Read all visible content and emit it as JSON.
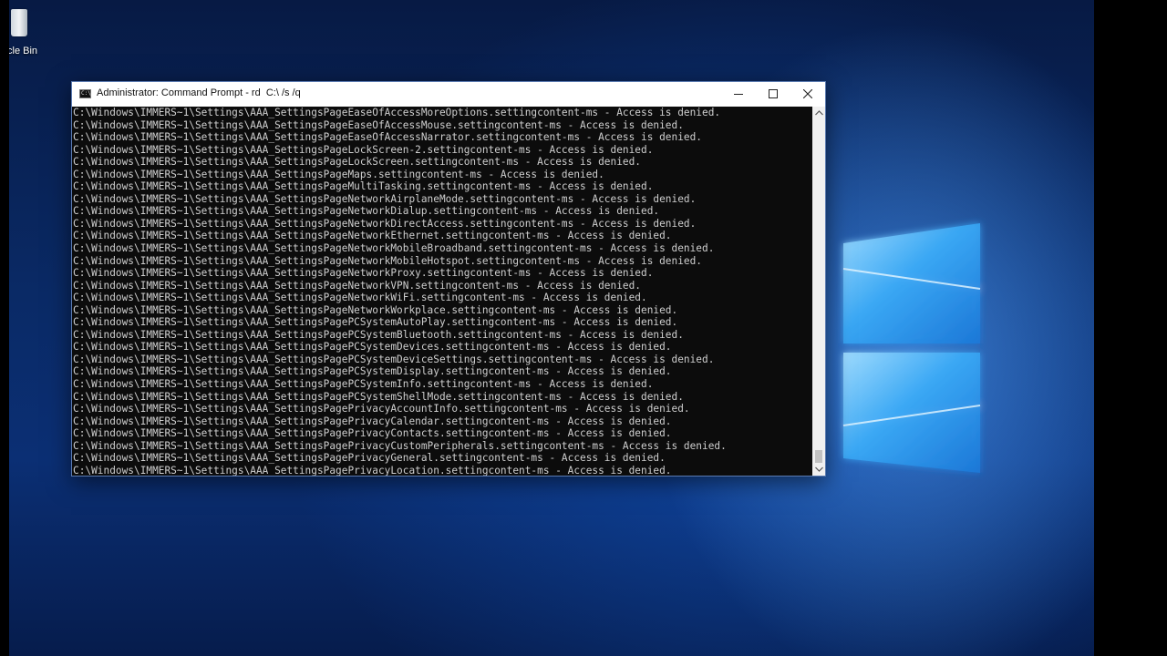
{
  "desktop": {
    "recycle_bin_label": "cle Bin"
  },
  "window": {
    "title": "Administrator: Command Prompt - rd  C:\\ /s /q",
    "icon_text": "C:\\",
    "buttons": {
      "minimize": "minimize-icon",
      "maximize": "maximize-icon",
      "close": "close-icon"
    }
  },
  "console": {
    "lines": [
      "C:\\Windows\\IMMERS~1\\Settings\\AAA_SettingsPageEaseOfAccessMoreOptions.settingcontent-ms - Access is denied.",
      "C:\\Windows\\IMMERS~1\\Settings\\AAA_SettingsPageEaseOfAccessMouse.settingcontent-ms - Access is denied.",
      "C:\\Windows\\IMMERS~1\\Settings\\AAA_SettingsPageEaseOfAccessNarrator.settingcontent-ms - Access is denied.",
      "C:\\Windows\\IMMERS~1\\Settings\\AAA_SettingsPageLockScreen-2.settingcontent-ms - Access is denied.",
      "C:\\Windows\\IMMERS~1\\Settings\\AAA_SettingsPageLockScreen.settingcontent-ms - Access is denied.",
      "C:\\Windows\\IMMERS~1\\Settings\\AAA_SettingsPageMaps.settingcontent-ms - Access is denied.",
      "C:\\Windows\\IMMERS~1\\Settings\\AAA_SettingsPageMultiTasking.settingcontent-ms - Access is denied.",
      "C:\\Windows\\IMMERS~1\\Settings\\AAA_SettingsPageNetworkAirplaneMode.settingcontent-ms - Access is denied.",
      "C:\\Windows\\IMMERS~1\\Settings\\AAA_SettingsPageNetworkDialup.settingcontent-ms - Access is denied.",
      "C:\\Windows\\IMMERS~1\\Settings\\AAA_SettingsPageNetworkDirectAccess.settingcontent-ms - Access is denied.",
      "C:\\Windows\\IMMERS~1\\Settings\\AAA_SettingsPageNetworkEthernet.settingcontent-ms - Access is denied.",
      "C:\\Windows\\IMMERS~1\\Settings\\AAA_SettingsPageNetworkMobileBroadband.settingcontent-ms - Access is denied.",
      "C:\\Windows\\IMMERS~1\\Settings\\AAA_SettingsPageNetworkMobileHotspot.settingcontent-ms - Access is denied.",
      "C:\\Windows\\IMMERS~1\\Settings\\AAA_SettingsPageNetworkProxy.settingcontent-ms - Access is denied.",
      "C:\\Windows\\IMMERS~1\\Settings\\AAA_SettingsPageNetworkVPN.settingcontent-ms - Access is denied.",
      "C:\\Windows\\IMMERS~1\\Settings\\AAA_SettingsPageNetworkWiFi.settingcontent-ms - Access is denied.",
      "C:\\Windows\\IMMERS~1\\Settings\\AAA_SettingsPageNetworkWorkplace.settingcontent-ms - Access is denied.",
      "C:\\Windows\\IMMERS~1\\Settings\\AAA_SettingsPagePCSystemAutoPlay.settingcontent-ms - Access is denied.",
      "C:\\Windows\\IMMERS~1\\Settings\\AAA_SettingsPagePCSystemBluetooth.settingcontent-ms - Access is denied.",
      "C:\\Windows\\IMMERS~1\\Settings\\AAA_SettingsPagePCSystemDevices.settingcontent-ms - Access is denied.",
      "C:\\Windows\\IMMERS~1\\Settings\\AAA_SettingsPagePCSystemDeviceSettings.settingcontent-ms - Access is denied.",
      "C:\\Windows\\IMMERS~1\\Settings\\AAA_SettingsPagePCSystemDisplay.settingcontent-ms - Access is denied.",
      "C:\\Windows\\IMMERS~1\\Settings\\AAA_SettingsPagePCSystemInfo.settingcontent-ms - Access is denied.",
      "C:\\Windows\\IMMERS~1\\Settings\\AAA_SettingsPagePCSystemShellMode.settingcontent-ms - Access is denied.",
      "C:\\Windows\\IMMERS~1\\Settings\\AAA_SettingsPagePrivacyAccountInfo.settingcontent-ms - Access is denied.",
      "C:\\Windows\\IMMERS~1\\Settings\\AAA_SettingsPagePrivacyCalendar.settingcontent-ms - Access is denied.",
      "C:\\Windows\\IMMERS~1\\Settings\\AAA_SettingsPagePrivacyContacts.settingcontent-ms - Access is denied.",
      "C:\\Windows\\IMMERS~1\\Settings\\AAA_SettingsPagePrivacyCustomPeripherals.settingcontent-ms - Access is denied.",
      "C:\\Windows\\IMMERS~1\\Settings\\AAA_SettingsPagePrivacyGeneral.settingcontent-ms - Access is denied.",
      "C:\\Windows\\IMMERS~1\\Settings\\AAA_SettingsPagePrivacyLocation.settingcontent-ms - Access is denied."
    ],
    "text_color": "#cfcfcf",
    "background_color": "#0c0c0c"
  },
  "scrollbar": {
    "up_icon": "scroll-up-arrow-icon",
    "down_icon": "scroll-down-arrow-icon",
    "position": 1.0
  },
  "colors": {
    "desktop_blue": "#0a2a66",
    "logo_light_blue": "#6fc3ff"
  }
}
